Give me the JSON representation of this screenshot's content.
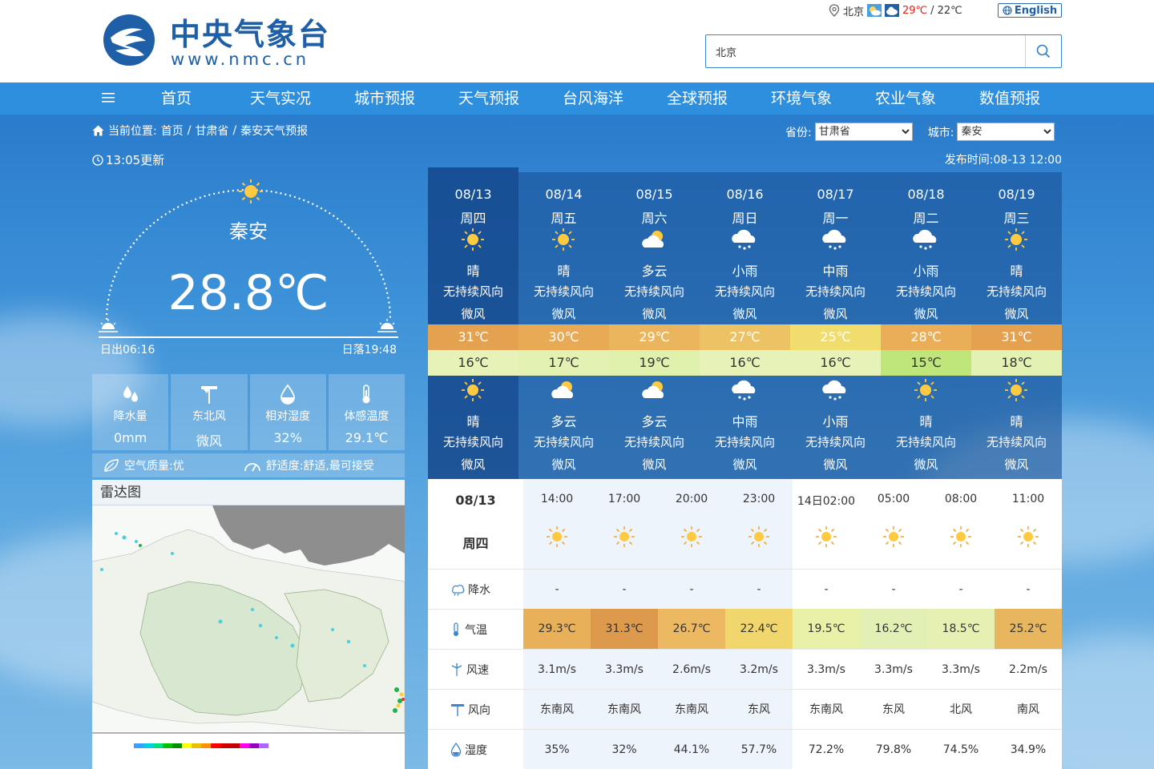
{
  "header": {
    "logo_cn": "中央气象台",
    "logo_url": "www.nmc.cn",
    "top_city": "北京",
    "top_high": "29℃",
    "top_sep": "/",
    "top_low": "22℃",
    "english": "English",
    "search_value": "北京"
  },
  "nav": {
    "items": [
      "首页",
      "天气实况",
      "城市预报",
      "天气预报",
      "台风海洋",
      "全球预报",
      "环境气象",
      "农业气象",
      "数值预报"
    ]
  },
  "breadcrumb": {
    "prefix": "当前位置:",
    "items": [
      "首页",
      "甘肃省",
      "秦安天气预报"
    ],
    "sep": "/"
  },
  "selectors": {
    "province_label": "省份:",
    "province_value": "甘肃省",
    "city_label": "城市:",
    "city_value": "秦安"
  },
  "update_time": "13:05更新",
  "publish_time": "发布时间:08-13 12:00",
  "current": {
    "city": "秦安",
    "temp": "28.8℃",
    "sunrise": "日出06:16",
    "sunset": "日落19:48"
  },
  "stats": [
    {
      "icon": "rain-drops-icon",
      "label": "降水量",
      "value": "0mm"
    },
    {
      "icon": "wind-vane-icon",
      "label": "东北风",
      "value": "微风"
    },
    {
      "icon": "humidity-drop-icon",
      "label": "相对湿度",
      "value": "32%"
    },
    {
      "icon": "thermometer-icon",
      "label": "体感温度",
      "value": "29.1℃"
    }
  ],
  "air": {
    "quality": "空气质量:优",
    "comfort": "舒适度:舒适,最可接受"
  },
  "radar": {
    "title": "雷达图"
  },
  "forecast": [
    {
      "date": "08/13",
      "week": "周四",
      "icon1": "sunny",
      "w1": "晴",
      "wd1": "无持续风向",
      "wp1": "微风",
      "high": "31℃",
      "low": "16℃",
      "icon2": "sunny",
      "w2": "晴",
      "wd2": "无持续风向",
      "wp2": "微风"
    },
    {
      "date": "08/14",
      "week": "周五",
      "icon1": "sunny",
      "w1": "晴",
      "wd1": "无持续风向",
      "wp1": "微风",
      "high": "30℃",
      "low": "17℃",
      "icon2": "cloudy",
      "w2": "多云",
      "wd2": "无持续风向",
      "wp2": "微风"
    },
    {
      "date": "08/15",
      "week": "周六",
      "icon1": "cloudy",
      "w1": "多云",
      "wd1": "无持续风向",
      "wp1": "微风",
      "high": "29℃",
      "low": "19℃",
      "icon2": "cloudy",
      "w2": "多云",
      "wd2": "无持续风向",
      "wp2": "微风"
    },
    {
      "date": "08/16",
      "week": "周日",
      "icon1": "rain",
      "w1": "小雨",
      "wd1": "无持续风向",
      "wp1": "微风",
      "high": "27℃",
      "low": "16℃",
      "icon2": "rain",
      "w2": "中雨",
      "wd2": "无持续风向",
      "wp2": "微风"
    },
    {
      "date": "08/17",
      "week": "周一",
      "icon1": "rain",
      "w1": "中雨",
      "wd1": "无持续风向",
      "wp1": "微风",
      "high": "25℃",
      "low": "16℃",
      "icon2": "rain",
      "w2": "小雨",
      "wd2": "无持续风向",
      "wp2": "微风"
    },
    {
      "date": "08/18",
      "week": "周二",
      "icon1": "rain",
      "w1": "小雨",
      "wd1": "无持续风向",
      "wp1": "微风",
      "high": "28℃",
      "low": "15℃",
      "icon2": "sunny",
      "w2": "晴",
      "wd2": "无持续风向",
      "wp2": "微风"
    },
    {
      "date": "08/19",
      "week": "周三",
      "icon1": "sunny",
      "w1": "晴",
      "wd1": "无持续风向",
      "wp1": "微风",
      "high": "31℃",
      "low": "18℃",
      "icon2": "sunny",
      "w2": "晴",
      "wd2": "无持续风向",
      "wp2": "微风"
    }
  ],
  "forecast_colors": {
    "high": [
      "#e4a150",
      "#e8aa55",
      "#ebb55e",
      "#edc265",
      "#f1dc6e",
      "#e9ae57",
      "#e4a150"
    ],
    "low": [
      "#e6f2b8",
      "#e3f1b3",
      "#e0f0ad",
      "#e6f2b8",
      "#e6f2b8",
      "#bfe67a",
      "#e3f1b3"
    ]
  },
  "hourly": {
    "date": "08/13",
    "week": "周四",
    "labels": [
      "降水",
      "气温",
      "风速",
      "风向",
      "湿度"
    ],
    "times": [
      "14:00",
      "17:00",
      "20:00",
      "23:00",
      "14日02:00",
      "05:00",
      "08:00",
      "11:00"
    ],
    "precip": [
      "-",
      "-",
      "-",
      "-",
      "-",
      "-",
      "-",
      "-"
    ],
    "temps": [
      "29.3℃",
      "31.3℃",
      "26.7℃",
      "22.4℃",
      "19.5℃",
      "16.2℃",
      "18.5℃",
      "25.2℃"
    ],
    "temp_colors": [
      "#e9b05a",
      "#dd9a4c",
      "#ecb862",
      "#f1d56d",
      "#e9f0a8",
      "#e3f0b5",
      "#e6f0b2",
      "#e8b65e"
    ],
    "wind_speed": [
      "3.1m/s",
      "3.3m/s",
      "2.6m/s",
      "3.2m/s",
      "3.3m/s",
      "3.3m/s",
      "3.3m/s",
      "2.2m/s"
    ],
    "wind_dir": [
      "东南风",
      "东南风",
      "东南风",
      "东风",
      "东南风",
      "东风",
      "北风",
      "南风"
    ],
    "humidity": [
      "35%",
      "32%",
      "44.1%",
      "57.7%",
      "72.2%",
      "79.8%",
      "74.5%",
      "34.9%"
    ]
  }
}
